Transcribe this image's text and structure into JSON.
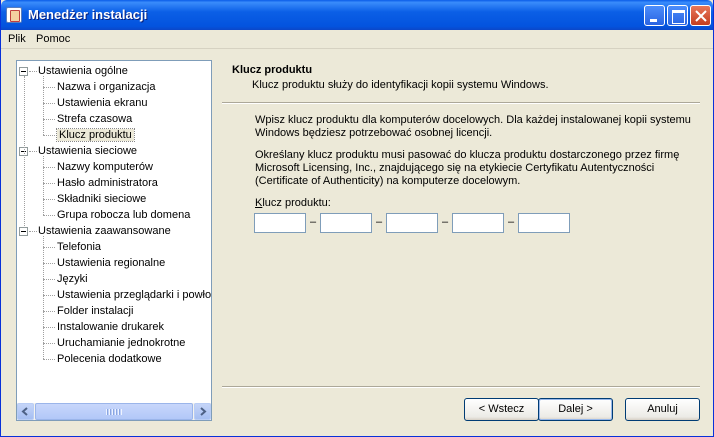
{
  "window": {
    "title": "Menedżer instalacji"
  },
  "menu": {
    "file": "Plik",
    "help": "Pomoc"
  },
  "tree": {
    "groups": [
      {
        "label": "Ustawienia ogólne",
        "children": [
          "Nazwa i organizacja",
          "Ustawienia ekranu",
          "Strefa czasowa",
          "Klucz produktu"
        ]
      },
      {
        "label": "Ustawienia sieciowe",
        "children": [
          "Nazwy komputerów",
          "Hasło administratora",
          "Składniki sieciowe",
          "Grupa robocza lub domena"
        ]
      },
      {
        "label": "Ustawienia zaawansowane",
        "children": [
          "Telefonia",
          "Ustawienia regionalne",
          "Języki",
          "Ustawienia przeglądarki i powłok",
          "Folder instalacji",
          "Instalowanie drukarek",
          "Uruchamianie jednokrotne",
          "Polecenia dodatkowe"
        ]
      }
    ],
    "selected": "Klucz produktu"
  },
  "header": {
    "title": "Klucz produktu",
    "subtitle": "Klucz produktu służy do identyfikacji kopii systemu Windows."
  },
  "body": {
    "para1": "Wpisz klucz produktu dla komputerów docelowych. Dla każdej instalowanej kopii systemu Windows będziesz potrzebować osobnej licencji.",
    "para2": "Określany klucz produktu musi pasować do klucza produktu dostarczonego przez firmę Microsoft Licensing, Inc., znajdującego się na etykiecie Certyfikatu Autentyczności (Certificate of Authenticity) na komputerze docelowym.",
    "key_label": "Klucz produktu:",
    "key_values": [
      "",
      "",
      "",
      "",
      ""
    ],
    "dash": "–"
  },
  "buttons": {
    "back": "< Wstecz",
    "next": "Dalej >",
    "cancel": "Anuluj"
  }
}
